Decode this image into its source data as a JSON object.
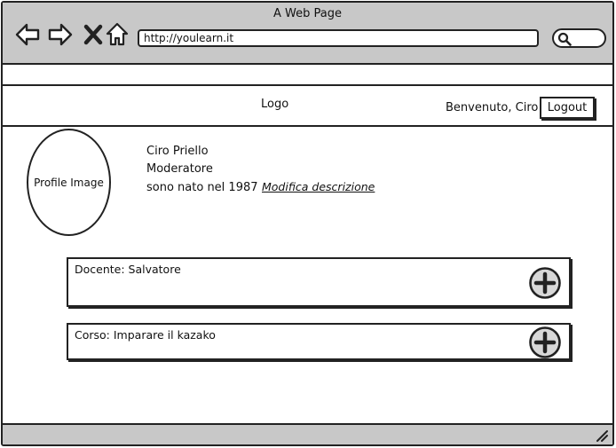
{
  "window": {
    "title": "A Web Page",
    "url": "http://youlearn.it",
    "icons": [
      "back-arrow-icon",
      "forward-arrow-icon",
      "close-x-icon",
      "home-icon",
      "search-icon"
    ]
  },
  "header": {
    "logo": "Logo",
    "welcome": "Benvenuto, Ciro",
    "logout_label": "Logout"
  },
  "profile": {
    "image_label": "Profile Image",
    "name": "Ciro Priello",
    "role": "Moderatore",
    "description": "sono nato nel 1987",
    "edit_link": "Modifica descrizione"
  },
  "cards": [
    {
      "label": "Docente: Salvatore",
      "action_icon": "plus-circle-icon"
    },
    {
      "label": "Corso: Imparare il kazako",
      "action_icon": "plus-circle-icon"
    }
  ]
}
